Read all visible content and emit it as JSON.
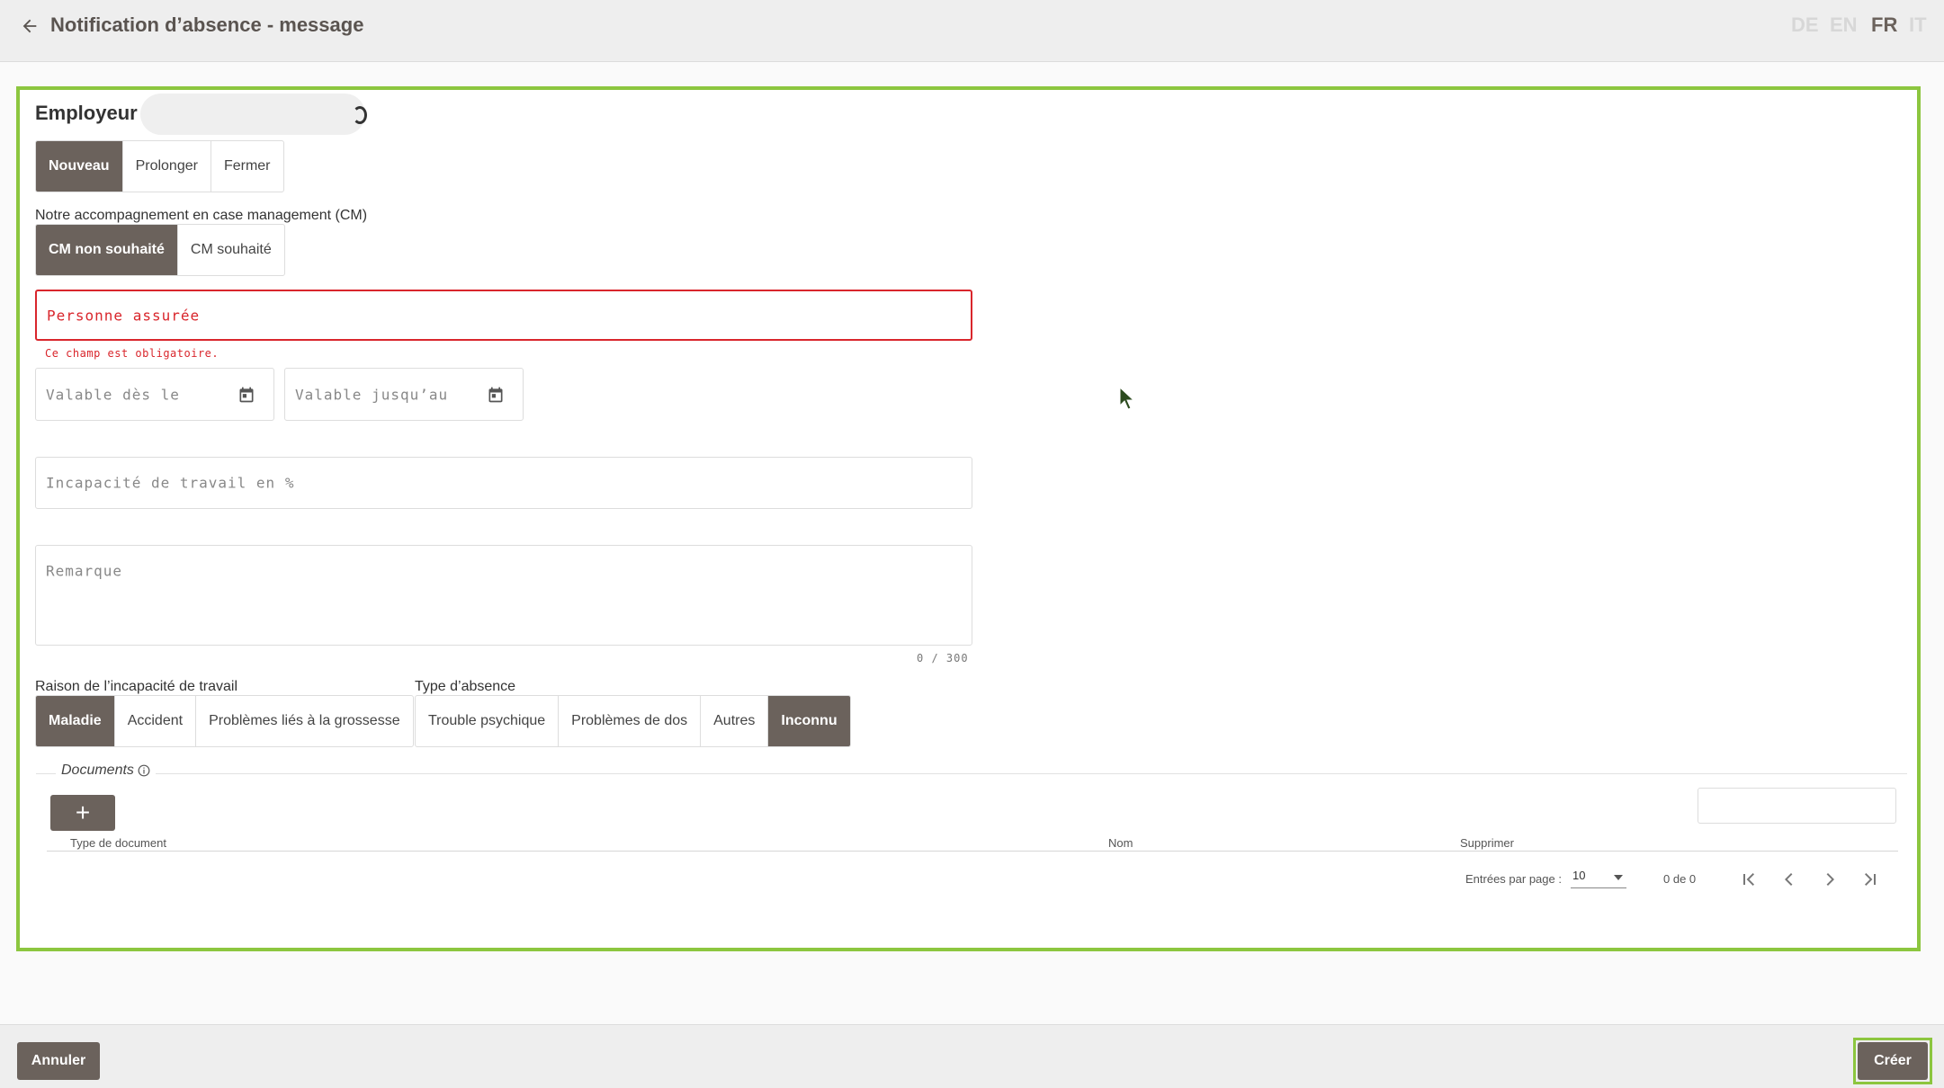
{
  "header": {
    "title": "Notification d’absence - message",
    "languages": [
      "DE",
      "EN",
      "FR",
      "IT"
    ],
    "active_language": "FR"
  },
  "form": {
    "employer_label": "Employeur :",
    "action_options": [
      "Nouveau",
      "Prolonger",
      "Fermer"
    ],
    "action_selected": "Nouveau",
    "cm_label": "Notre accompagnement en case management (CM)",
    "cm_options": [
      "CM non souhaité",
      "CM souhaité"
    ],
    "cm_selected": "CM non souhaité",
    "insured_person_placeholder": "Personne assurée",
    "insured_person_error": "Ce champ est obligatoire.",
    "valid_from_placeholder": "Valable dès le",
    "valid_until_placeholder": "Valable jusqu’au",
    "incapacity_placeholder": "Incapacité de travail en %",
    "remark_placeholder": "Remarque",
    "remark_counter": "0 / 300",
    "reason_label": "Raison de l’incapacité de travail",
    "reason_options": [
      "Maladie",
      "Accident",
      "Problèmes liés à la grossesse"
    ],
    "reason_selected": "Maladie",
    "absence_type_label": "Type d’absence",
    "absence_type_options": [
      "Trouble psychique",
      "Problèmes de dos",
      "Autres",
      "Inconnu"
    ],
    "absence_type_selected": "Inconnu"
  },
  "documents": {
    "title": "Documents",
    "add_label": "+",
    "columns": [
      "Type de document",
      "Nom",
      "Supprimer"
    ],
    "rows": [],
    "entries_per_page_label": "Entrées par page :",
    "entries_per_page": "10",
    "range": "0 de 0"
  },
  "footer": {
    "cancel_label": "Annuler",
    "create_label": "Créer"
  },
  "colors": {
    "accent_brown": "#6b625c",
    "highlight_green": "#8cc63f",
    "error_red": "#d9262c"
  }
}
